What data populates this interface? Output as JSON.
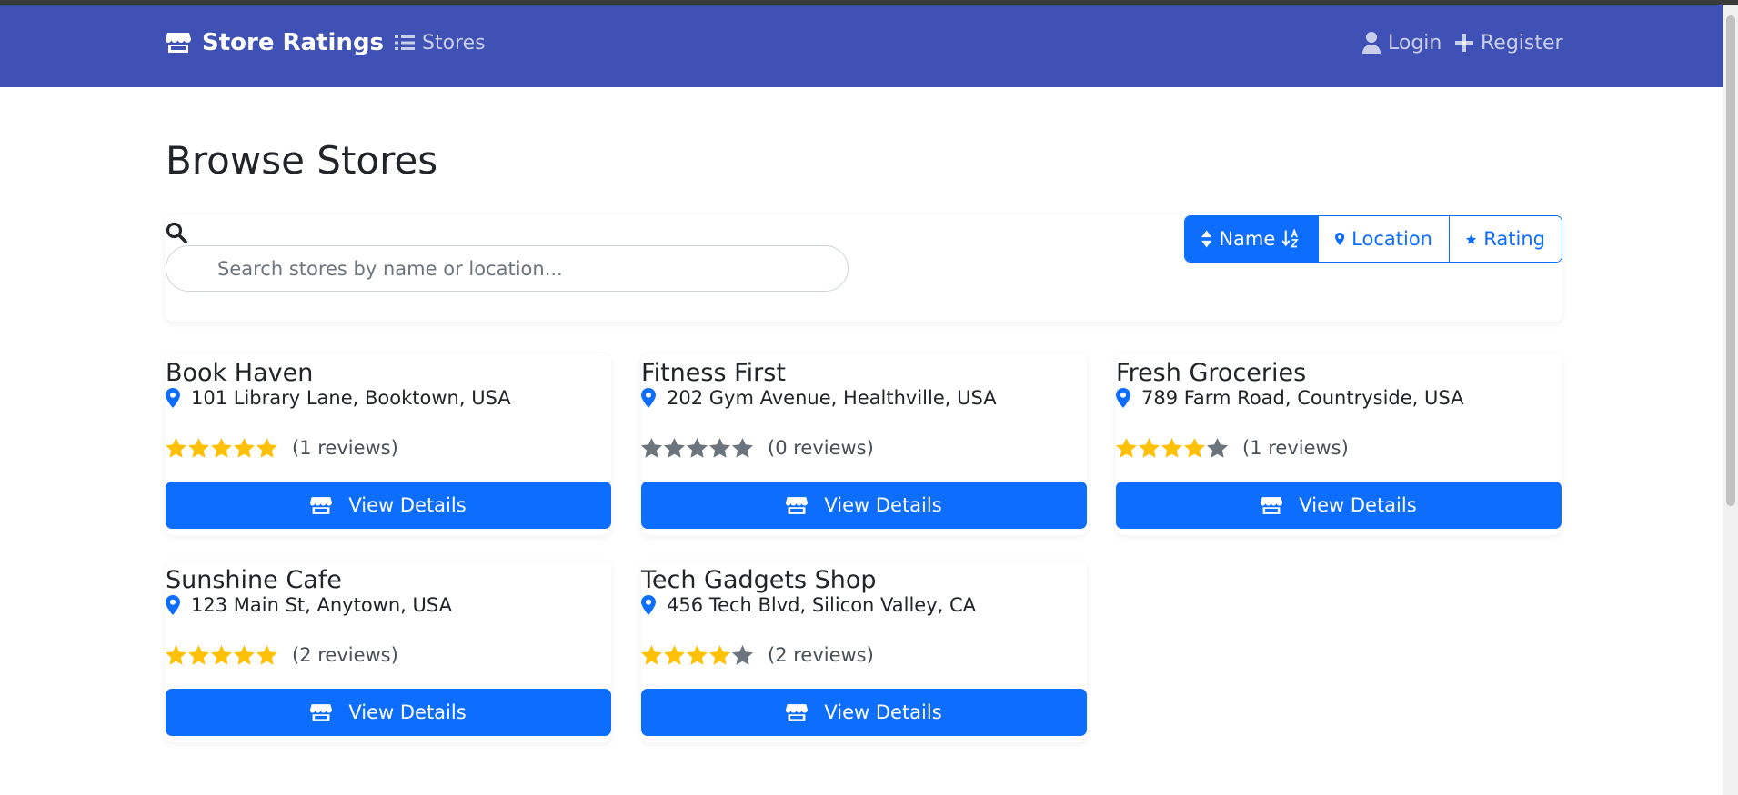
{
  "header": {
    "brand": "Store Ratings",
    "nav_stores": "Stores",
    "login": "Login",
    "register": "Register"
  },
  "page": {
    "title": "Browse Stores"
  },
  "search": {
    "placeholder": "Search stores by name or location..."
  },
  "sort": {
    "name": "Name",
    "location": "Location",
    "rating": "Rating"
  },
  "stores": [
    {
      "name": "Book Haven",
      "address": "101 Library Lane, Booktown, USA",
      "rating": 5,
      "reviews": "(1 reviews)",
      "button": "View Details"
    },
    {
      "name": "Fitness First",
      "address": "202 Gym Avenue, Healthville, USA",
      "rating": 0,
      "reviews": "(0 reviews)",
      "button": "View Details"
    },
    {
      "name": "Fresh Groceries",
      "address": "789 Farm Road, Countryside, USA",
      "rating": 4,
      "reviews": "(1 reviews)",
      "button": "View Details"
    },
    {
      "name": "Sunshine Cafe",
      "address": "123 Main St, Anytown, USA",
      "rating": 5,
      "reviews": "(2 reviews)",
      "button": "View Details"
    },
    {
      "name": "Tech Gadgets Shop",
      "address": "456 Tech Blvd, Silicon Valley, CA",
      "rating": 4,
      "reviews": "(2 reviews)",
      "button": "View Details"
    }
  ],
  "colors": {
    "navbar": "#3f51b5",
    "primary": "#0d6efd",
    "star_filled": "#ffc107",
    "star_empty": "#6c757d"
  }
}
